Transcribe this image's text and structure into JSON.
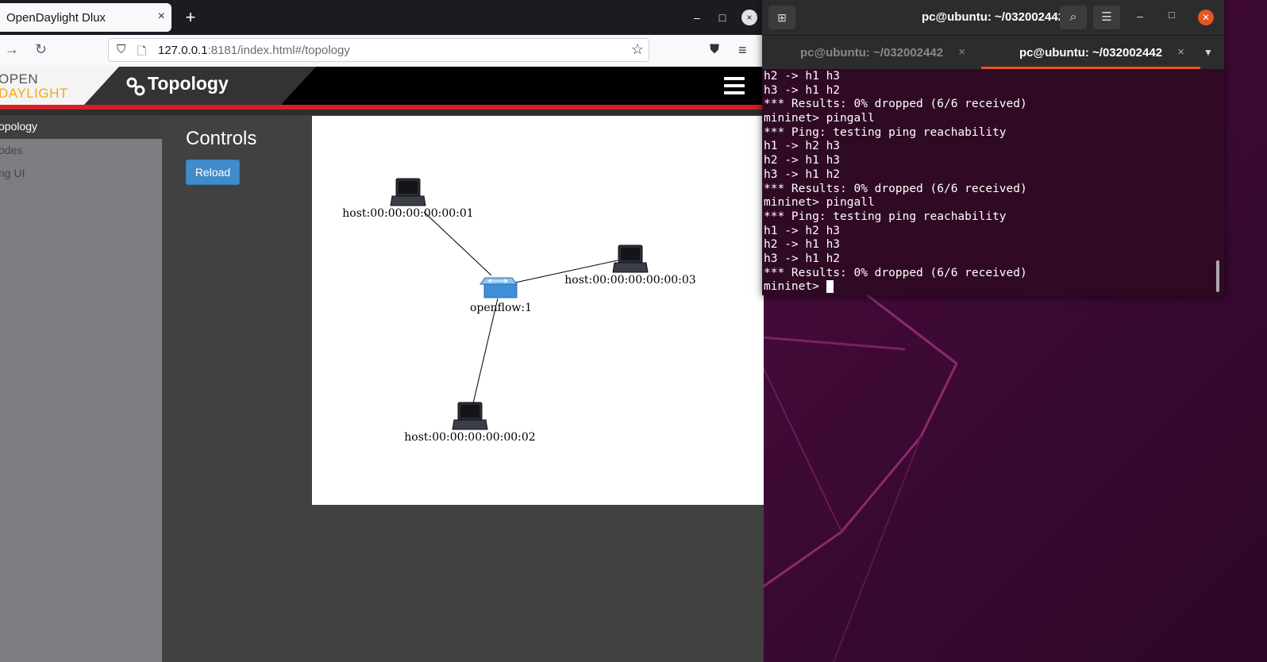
{
  "browser": {
    "tab_title": "OpenDaylight Dlux",
    "tab_close": "×",
    "new_tab": "+",
    "url_host": "127.0.0.1",
    "url_rest": ":8181/index.html#/topology",
    "window_min": "–",
    "window_max": "□",
    "window_close": "×"
  },
  "odl": {
    "logo_line1": "OPEN",
    "logo_line2": "DAYLIGHT",
    "header_title": "Topology",
    "sidebar": [
      {
        "label": "opology"
      },
      {
        "label": "odes"
      },
      {
        "label": "ng UI"
      }
    ],
    "controls_title": "Controls",
    "reload_label": "Reload",
    "topology": {
      "switch": "openflow:1",
      "hosts": [
        {
          "label": "host:00:00:00:00:00:01"
        },
        {
          "label": "host:00:00:00:00:00:02"
        },
        {
          "label": "host:00:00:00:00:00:03"
        }
      ]
    }
  },
  "terminal": {
    "title": "pc@ubuntu: ~/032002442",
    "tabs": [
      {
        "label": "pc@ubuntu: ~/032002442",
        "active": false
      },
      {
        "label": "pc@ubuntu: ~/032002442",
        "active": true
      }
    ],
    "lines": [
      "h2 -> h1 h3",
      "h3 -> h1 h2",
      "*** Results: 0% dropped (6/6 received)",
      "mininet> pingall",
      "*** Ping: testing ping reachability",
      "h1 -> h2 h3",
      "h2 -> h1 h3",
      "h3 -> h1 h2",
      "*** Results: 0% dropped (6/6 received)",
      "mininet> pingall",
      "*** Ping: testing ping reachability",
      "h1 -> h2 h3",
      "h2 -> h1 h3",
      "h3 -> h1 h2",
      "*** Results: 0% dropped (6/6 received)"
    ],
    "prompt": "mininet> "
  },
  "colors": {
    "accent_orange": "#e95420",
    "odl_red": "#d61f26",
    "reload_blue": "#428bca",
    "terminal_bg": "#300a24"
  }
}
